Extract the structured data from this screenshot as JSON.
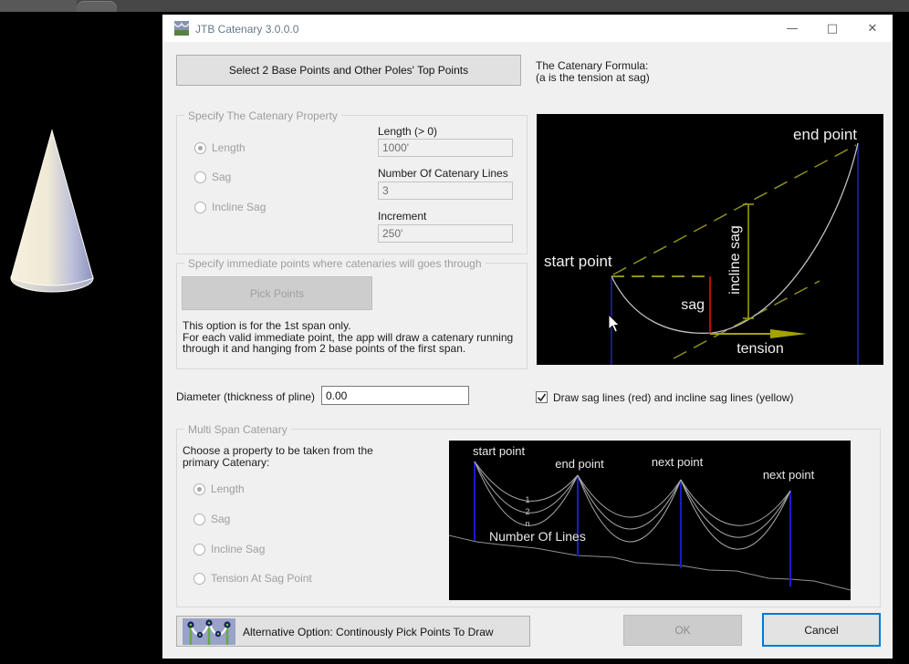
{
  "accent": "#0078d7",
  "titlebar": {
    "title": "JTB Catenary 3.0.0.0",
    "minimize": "—",
    "maximize": "□",
    "close": "✕"
  },
  "toolbar": {
    "select_button": "Select 2 Base Points and Other Poles' Top Points"
  },
  "formula_note": {
    "line1": "The Catenary Formula:",
    "line2": "(a is the tension at sag)"
  },
  "property_group": {
    "title": "Specify The Catenary Property",
    "radios": [
      {
        "label": "Length",
        "selected": true
      },
      {
        "label": "Sag",
        "selected": false
      },
      {
        "label": "Incline Sag",
        "selected": false
      }
    ],
    "fields": [
      {
        "label": "Length (> 0)",
        "value": "1000'"
      },
      {
        "label": "Number Of Catenary Lines",
        "value": "3"
      },
      {
        "label": "Increment",
        "value": "250'"
      }
    ]
  },
  "immediate_group": {
    "title": "Specify immediate points where catenaries will goes through",
    "pick_button": "Pick Points",
    "note1": "This option is for the 1st span only.",
    "note2": "For each valid immediate point, the app will draw a catenary running",
    "note3": "through it and  hanging from 2 base points of the first span."
  },
  "diameter": {
    "label": "Diameter (thickness of pline)",
    "value": "0.00"
  },
  "sag_option": {
    "label": "Draw sag lines (red) and incline sag lines (yellow)",
    "checked": true
  },
  "formula_diagram": {
    "start_point": "start point",
    "end_point": "end point",
    "sag": "sag",
    "incline_sag": "incline sag",
    "tension": "tension",
    "colors": {
      "curve": "#c0c0c0",
      "pole": "#2323bd",
      "guide": "#8f8f1f",
      "sag_line": "#b01010",
      "background": "#000000"
    }
  },
  "multi_span_group": {
    "title": "Multi Span Catenary",
    "caption1": "Choose a property to be taken from the",
    "caption2": "primary Catenary:",
    "radios": [
      {
        "label": "Length",
        "selected": true
      },
      {
        "label": "Sag",
        "selected": false
      },
      {
        "label": "Incline Sag",
        "selected": false
      },
      {
        "label": "Tension At Sag Point",
        "selected": false
      }
    ],
    "diagram": {
      "start_point": "start point",
      "end_point": "end point",
      "next_point1": "next point",
      "next_point2": "next point",
      "line1": "1",
      "line2": "2",
      "linen": "n",
      "number_of_lines": "Number Of Lines"
    }
  },
  "footer": {
    "alt_button": "Alternative Option: Continously Pick Points To Draw",
    "ok": "OK",
    "cancel": "Cancel"
  }
}
